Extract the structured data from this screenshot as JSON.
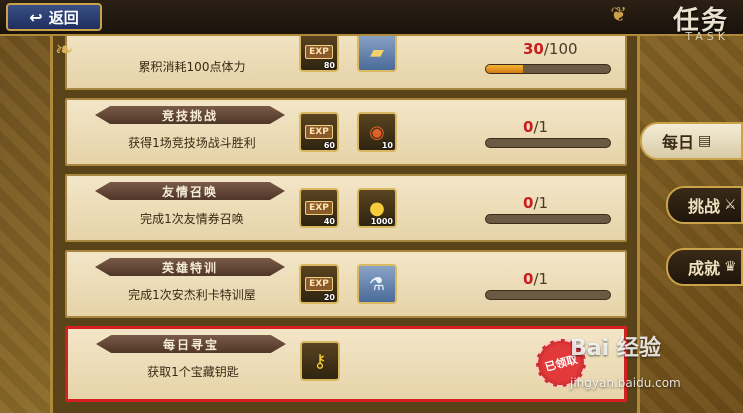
{
  "header": {
    "back_label": "返回",
    "title": "任务",
    "subtitle": "TASK"
  },
  "side_tabs": [
    {
      "label": "每日",
      "icon": "book-icon",
      "active": true
    },
    {
      "label": "挑战",
      "icon": "sword-icon",
      "active": false
    },
    {
      "label": "成就",
      "icon": "trophy-icon",
      "active": false
    }
  ],
  "tasks": [
    {
      "name": "",
      "description": "累积消耗100点体力",
      "rewards": [
        {
          "icon": "exp-chest-icon",
          "tag": "EXP",
          "qty": "80"
        },
        {
          "icon": "stamina-card-icon",
          "tag": "",
          "qty": ""
        }
      ],
      "progress_current": "30",
      "progress_total": "/100",
      "progress_fraction": 0.3,
      "claimed": false
    },
    {
      "name": "竞技挑战",
      "description": "获得1场竞技场战斗胜利",
      "rewards": [
        {
          "icon": "exp-chest-icon",
          "tag": "EXP",
          "qty": "60"
        },
        {
          "icon": "arena-medal-icon",
          "tag": "",
          "qty": "10"
        }
      ],
      "progress_current": "0",
      "progress_total": "/1",
      "progress_fraction": 0,
      "claimed": false
    },
    {
      "name": "友情召唤",
      "description": "完成1次友情券召唤",
      "rewards": [
        {
          "icon": "exp-chest-icon",
          "tag": "EXP",
          "qty": "40"
        },
        {
          "icon": "gold-coin-icon",
          "tag": "",
          "qty": "1000"
        }
      ],
      "progress_current": "0",
      "progress_total": "/1",
      "progress_fraction": 0,
      "claimed": false
    },
    {
      "name": "英雄特训",
      "description": "完成1次安杰利卡特训屋",
      "rewards": [
        {
          "icon": "exp-chest-icon",
          "tag": "EXP",
          "qty": "20"
        },
        {
          "icon": "potion-icon",
          "tag": "",
          "qty": ""
        }
      ],
      "progress_current": "0",
      "progress_total": "/1",
      "progress_fraction": 0,
      "claimed": false
    },
    {
      "name": "每日寻宝",
      "description": "获取1个宝藏钥匙",
      "rewards": [
        {
          "icon": "key-icon",
          "tag": "",
          "qty": ""
        }
      ],
      "progress_current": "",
      "progress_total": "",
      "progress_fraction": 1,
      "claimed": true,
      "claimed_label": "已领取"
    }
  ],
  "watermark": {
    "main": "Bai 经验",
    "sub": "jingyan.baidu.com"
  }
}
